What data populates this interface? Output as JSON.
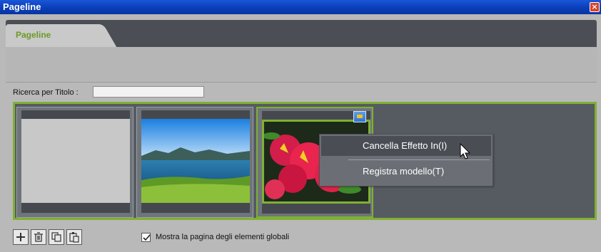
{
  "window": {
    "title": "Pageline"
  },
  "tabs": [
    {
      "label": "Pageline"
    }
  ],
  "search": {
    "label": "Ricerca per Titolo :",
    "value": ""
  },
  "pages": [
    {
      "kind": "blank"
    },
    {
      "kind": "landscape"
    },
    {
      "kind": "flower",
      "selected": true
    }
  ],
  "context_menu": {
    "items": [
      {
        "label": "Cancella Effetto In(I)"
      },
      {
        "label": "Registra modello(T)"
      }
    ]
  },
  "toolbar": {
    "buttons": [
      {
        "icon": "plus-icon"
      },
      {
        "icon": "trash-icon"
      },
      {
        "icon": "copy-icon"
      },
      {
        "icon": "paste-icon"
      }
    ]
  },
  "global_elements": {
    "label": "Mostra la pagina degli elementi globali",
    "checked": true
  },
  "colors": {
    "accent": "#7fb034",
    "titlebar": "#0a3fb8",
    "strip": "#565b62"
  }
}
